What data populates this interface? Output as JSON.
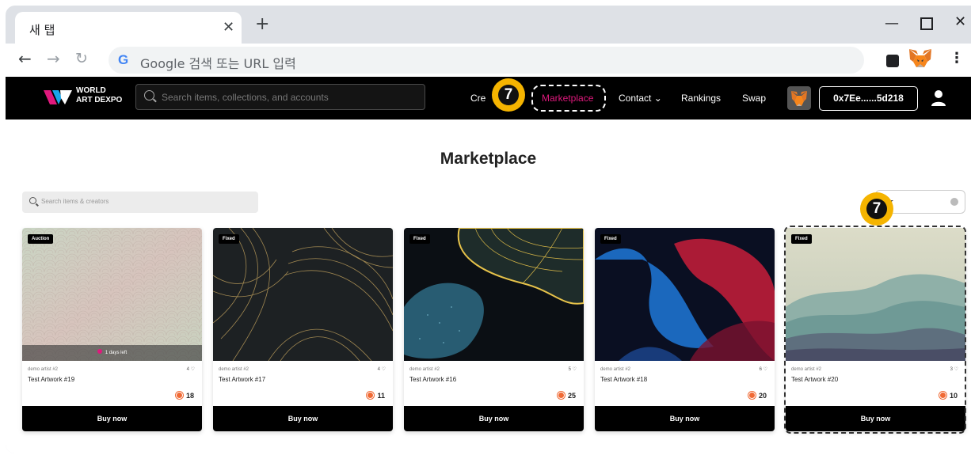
{
  "browser": {
    "tab_title": "새 탭",
    "tab_close": "✕",
    "new_tab": "+",
    "address_placeholder": "Google 검색 또는 URL 입력",
    "google_logo": "G",
    "window_minimize": "—",
    "window_close": "✕",
    "menu": "⋮"
  },
  "header": {
    "logo_line1": "WORLD",
    "logo_line2": "ART DEXPO",
    "search_placeholder": "Search items, collections, and accounts",
    "nav": {
      "create": "Cre",
      "marketplace": "Marketplace",
      "contact": "Contact ⌄",
      "rankings": "Rankings",
      "swap": "Swap"
    },
    "wallet": "0x7Ee......5d218",
    "marketplace_color": "#e0197d"
  },
  "callout": "7",
  "page": {
    "title": "Marketplace",
    "search_placeholder": "Search items & creators",
    "filter_label": "r"
  },
  "cards": [
    {
      "type": "Auction",
      "artist": "demo artist #2",
      "likes": "4 ♡",
      "title": "Test Artwork #19",
      "price": "18",
      "buy": "Buy now",
      "timer": "1 days left"
    },
    {
      "type": "Fixed",
      "artist": "demo artist #2",
      "likes": "4 ♡",
      "title": "Test Artwork #17",
      "price": "11",
      "buy": "Buy now"
    },
    {
      "type": "Fixed",
      "artist": "demo artist #2",
      "likes": "5 ♡",
      "title": "Test Artwork #16",
      "price": "25",
      "buy": "Buy now"
    },
    {
      "type": "Fixed",
      "artist": "demo artist #2",
      "likes": "6 ♡",
      "title": "Test Artwork #18",
      "price": "20",
      "buy": "Buy now"
    },
    {
      "type": "Fixed",
      "artist": "demo artist #2",
      "likes": "3 ♡",
      "title": "Test Artwork #20",
      "price": "10",
      "buy": "Buy now"
    }
  ]
}
